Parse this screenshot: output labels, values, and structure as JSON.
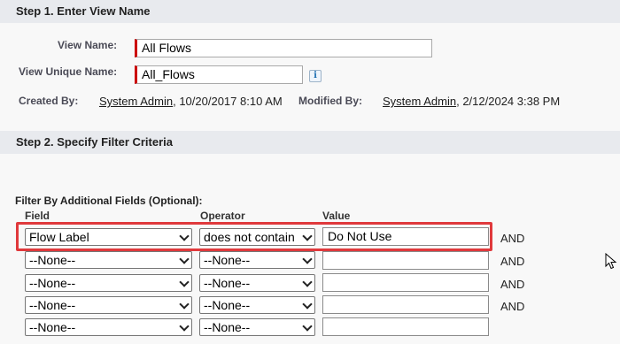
{
  "step1": {
    "title": "Step 1. Enter View Name",
    "view_name_label": "View Name:",
    "view_name_value": "All Flows",
    "unique_name_label": "View Unique Name:",
    "unique_name_value": "All_Flows",
    "info_icon": "info-icon",
    "created_by_label": "Created By:",
    "created_by_user": "System Admin",
    "created_by_date": ", 10/20/2017 8:10 AM",
    "modified_by_label": "Modified By:",
    "modified_by_user": "System Admin",
    "modified_by_date": ", 2/12/2024 3:38 PM"
  },
  "step2": {
    "title": "Step 2. Specify Filter Criteria",
    "filter_heading": "Filter By Additional Fields (Optional):",
    "columns": {
      "field": "Field",
      "operator": "Operator",
      "value": "Value"
    },
    "rows": [
      {
        "field": "Flow Label",
        "operator": "does not contain",
        "value": "Do Not Use",
        "conjunction": "AND"
      },
      {
        "field": "--None--",
        "operator": "--None--",
        "value": "",
        "conjunction": "AND"
      },
      {
        "field": "--None--",
        "operator": "--None--",
        "value": "",
        "conjunction": "AND"
      },
      {
        "field": "--None--",
        "operator": "--None--",
        "value": "",
        "conjunction": "AND"
      },
      {
        "field": "--None--",
        "operator": "--None--",
        "value": "",
        "conjunction": ""
      }
    ]
  },
  "colors": {
    "highlight": "#e0393c",
    "required": "#cc0000",
    "section_bar": "#e8eaee"
  }
}
